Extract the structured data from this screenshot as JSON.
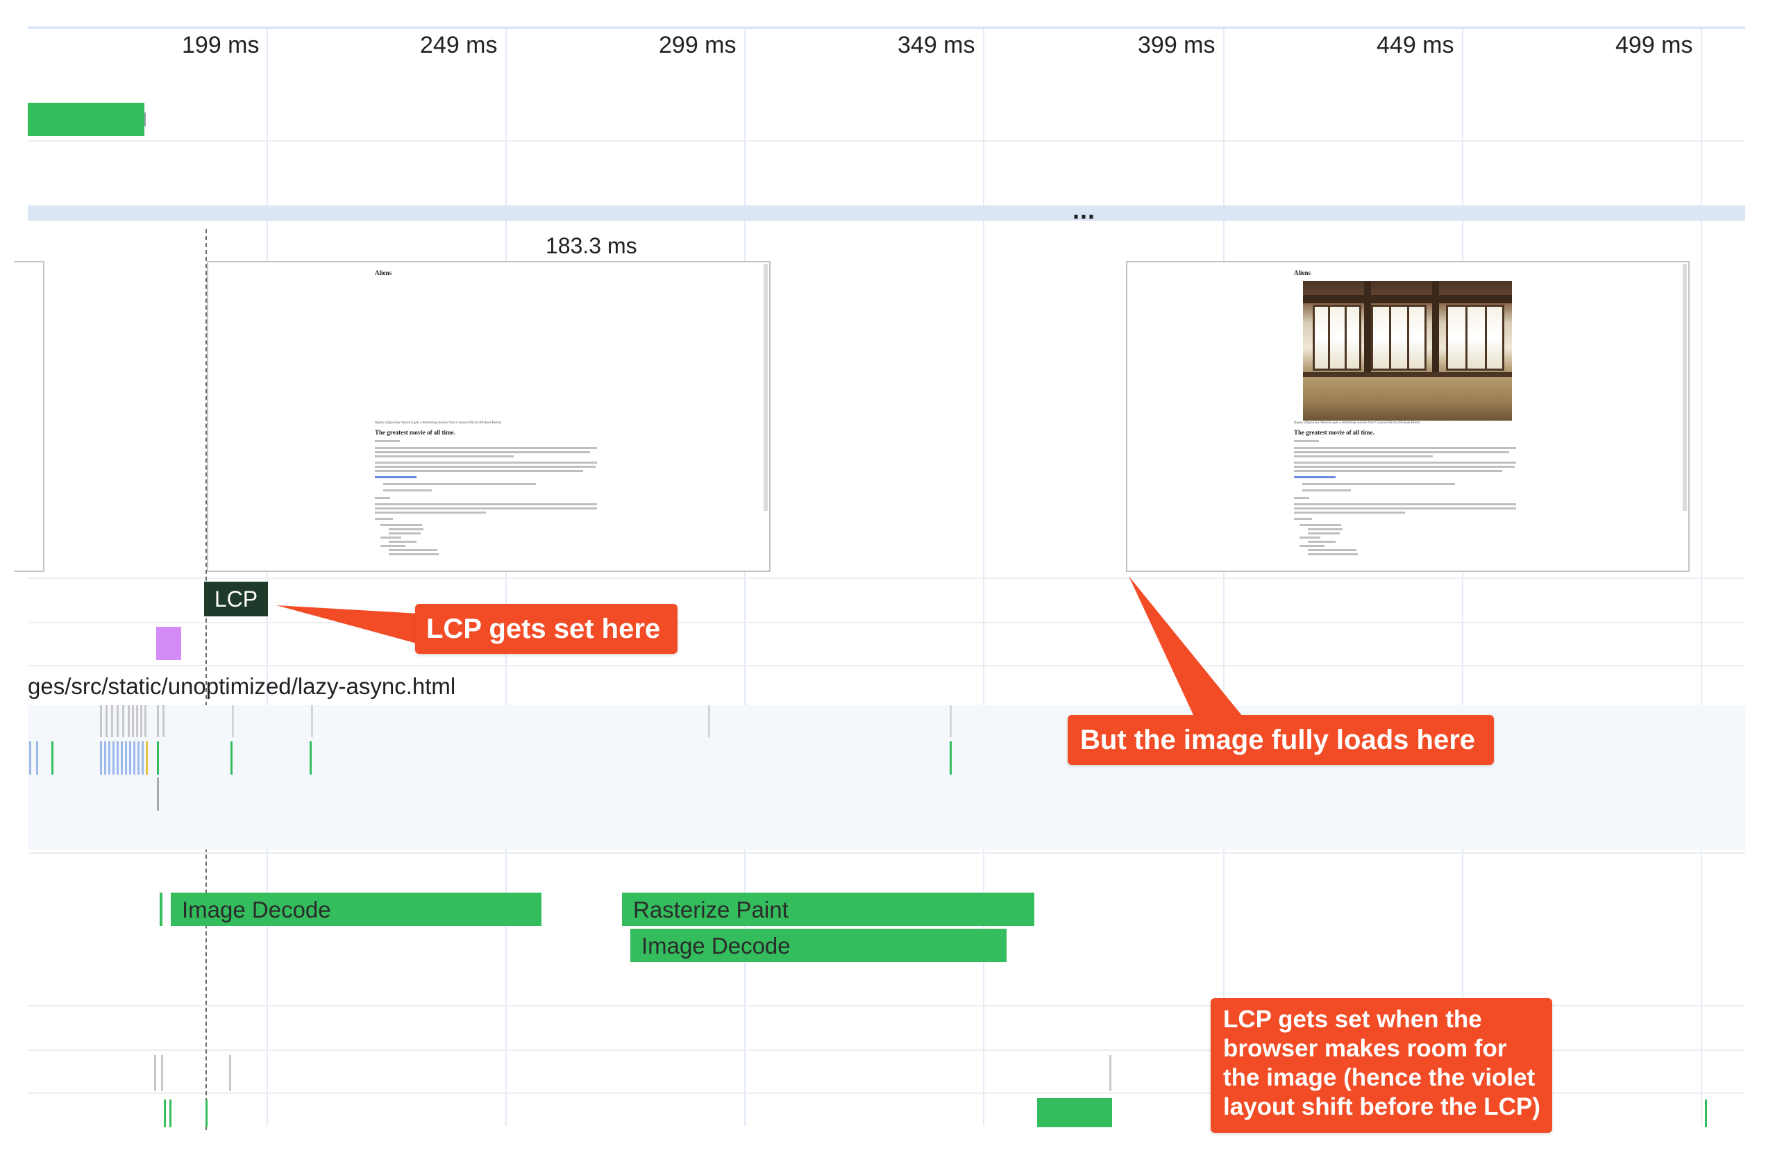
{
  "ruler": {
    "ticks": [
      "199 ms",
      "249 ms",
      "299 ms",
      "349 ms",
      "399 ms",
      "449 ms",
      "499 ms"
    ],
    "overflow": "..."
  },
  "filmstrip": {
    "duration": "183.3 ms",
    "frame1": {
      "title": "Aliens",
      "caption": "Ripley (Sigourney Weaver) gets a debriefing session from Corporal Hicks (Michael Biehn)",
      "heading": "The greatest movie of all time."
    },
    "frame2": {
      "title": "Aliens",
      "caption": "Ripley (Sigourney Weaver) gets a debriefing session from Corporal Hicks (Michael Biehn)",
      "heading": "The greatest movie of all time."
    }
  },
  "markers": {
    "lcp": "LCP"
  },
  "network": {
    "url": "ges/src/static/unoptimized/lazy-async.html"
  },
  "tasks": {
    "image_decode_1": "Image Decode",
    "rasterize_paint": "Rasterize Paint",
    "image_decode_2": "Image Decode"
  },
  "callouts": {
    "lcp_set": "LCP gets set here",
    "image_loads": "But the image fully loads here",
    "explanation": "LCP gets set when the browser makes room for the image (hence the violet layout shift before the LCP)"
  },
  "colors": {
    "accent_green": "#34bd5d",
    "callout_orange": "#f24c26",
    "layout_shift_violet": "#d38cf5",
    "lcp_badge": "#1e3a2b"
  }
}
